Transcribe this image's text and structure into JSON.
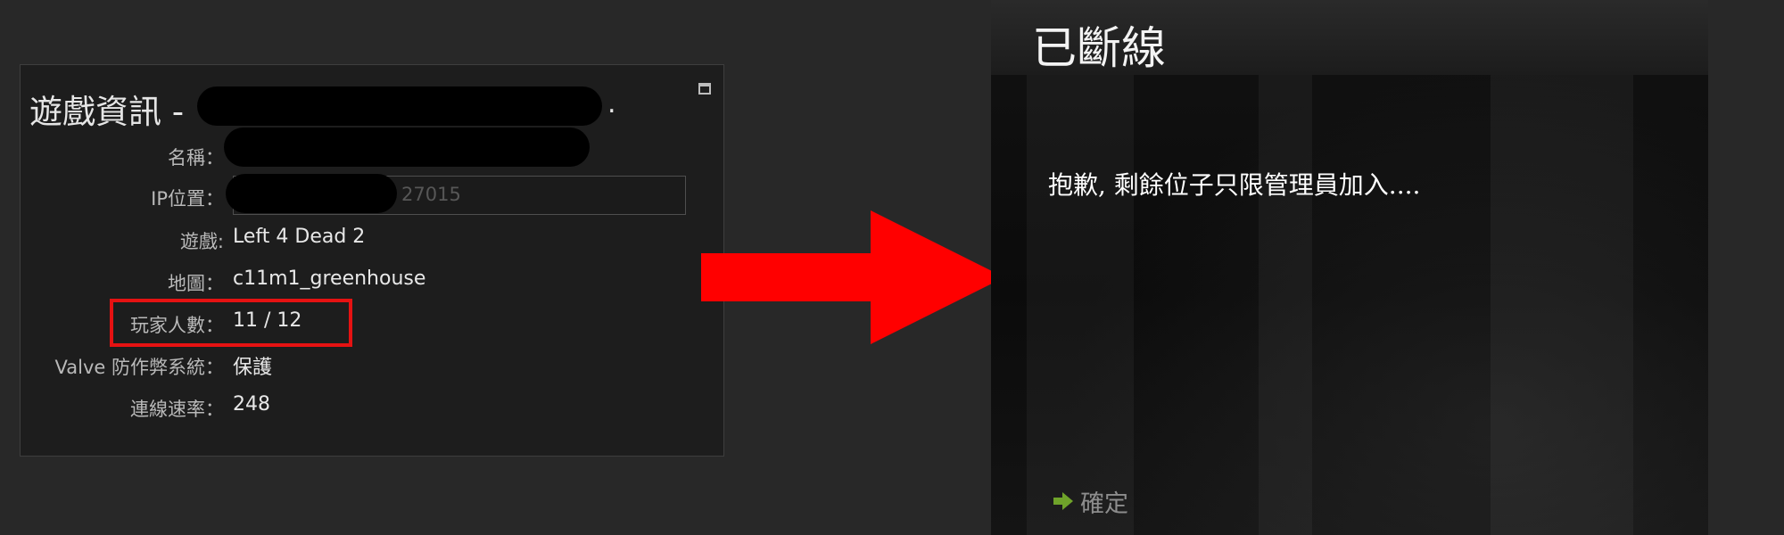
{
  "info_dialog": {
    "title": "遊戲資訊 -",
    "title_suffix": ".",
    "maximize_icon": "maximize-icon",
    "rows": {
      "name": {
        "label": "名稱：",
        "value": ""
      },
      "ip": {
        "label": "IP位置：",
        "port": "27015"
      },
      "game": {
        "label": "遊戲:",
        "value": "Left 4 Dead 2"
      },
      "map": {
        "label": "地圖：",
        "value": "c11m1_greenhouse"
      },
      "players": {
        "label": "玩家人數：",
        "value": "11 / 12"
      },
      "vac": {
        "label": "Valve 防作弊系統：",
        "value": "保護"
      },
      "latency": {
        "label": "連線速率：",
        "value": "248"
      }
    },
    "highlight_color": "#e51212"
  },
  "arrow": {
    "icon": "red-arrow-icon",
    "color": "#ff0000"
  },
  "disconnect_dialog": {
    "title": "已斷線",
    "message": "抱歉, 剩餘位子只限管理員加入....",
    "confirm_label": "確定",
    "confirm_icon": "green-arrow-icon",
    "confirm_icon_color": "#6fa32a"
  }
}
